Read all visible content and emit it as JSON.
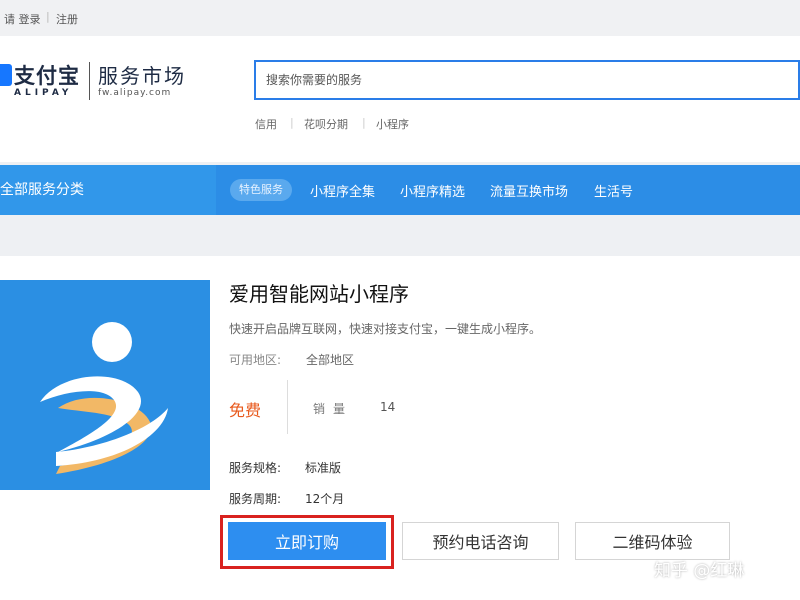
{
  "topbar": {
    "login": "请 登录",
    "register": "注册"
  },
  "header": {
    "logo": {
      "brand_cn": "支付宝",
      "brand_en": "ALIPAY",
      "market_title": "服务市场",
      "market_url": "fw.alipay.com",
      "accent_color": "#1677ff"
    },
    "search": {
      "placeholder": "搜索你需要的服务",
      "icon": "search"
    },
    "hot_keywords": [
      "信用",
      "花呗分期",
      "小程序"
    ]
  },
  "nav": {
    "all_categories": "全部服务分类",
    "badge": "特色服务",
    "items": [
      "小程序全集",
      "小程序精选",
      "流量互换市场",
      "生活号"
    ],
    "bg_color": "#2c8de6"
  },
  "product": {
    "title": "爱用智能网站小程序",
    "description": "快速开启品牌互联网，快速对接支付宝，一键生成小程序。",
    "region_label": "可用地区:",
    "region_value": "全部地区",
    "price": "免费",
    "sales_label": "销量",
    "sales_value": "14",
    "spec_label": "服务规格:",
    "spec_value": "标准版",
    "period_label": "服务周期:",
    "period_value": "12个月",
    "icon_colors": {
      "bg": "#2b8fe3",
      "shape": "#ffffff",
      "accent": "#f2b866"
    }
  },
  "actions": {
    "buy": "立即订购",
    "call": "预约电话咨询",
    "qr": "二维码体验",
    "highlight_color": "#d9221f"
  },
  "watermark": "知乎 @红琳"
}
